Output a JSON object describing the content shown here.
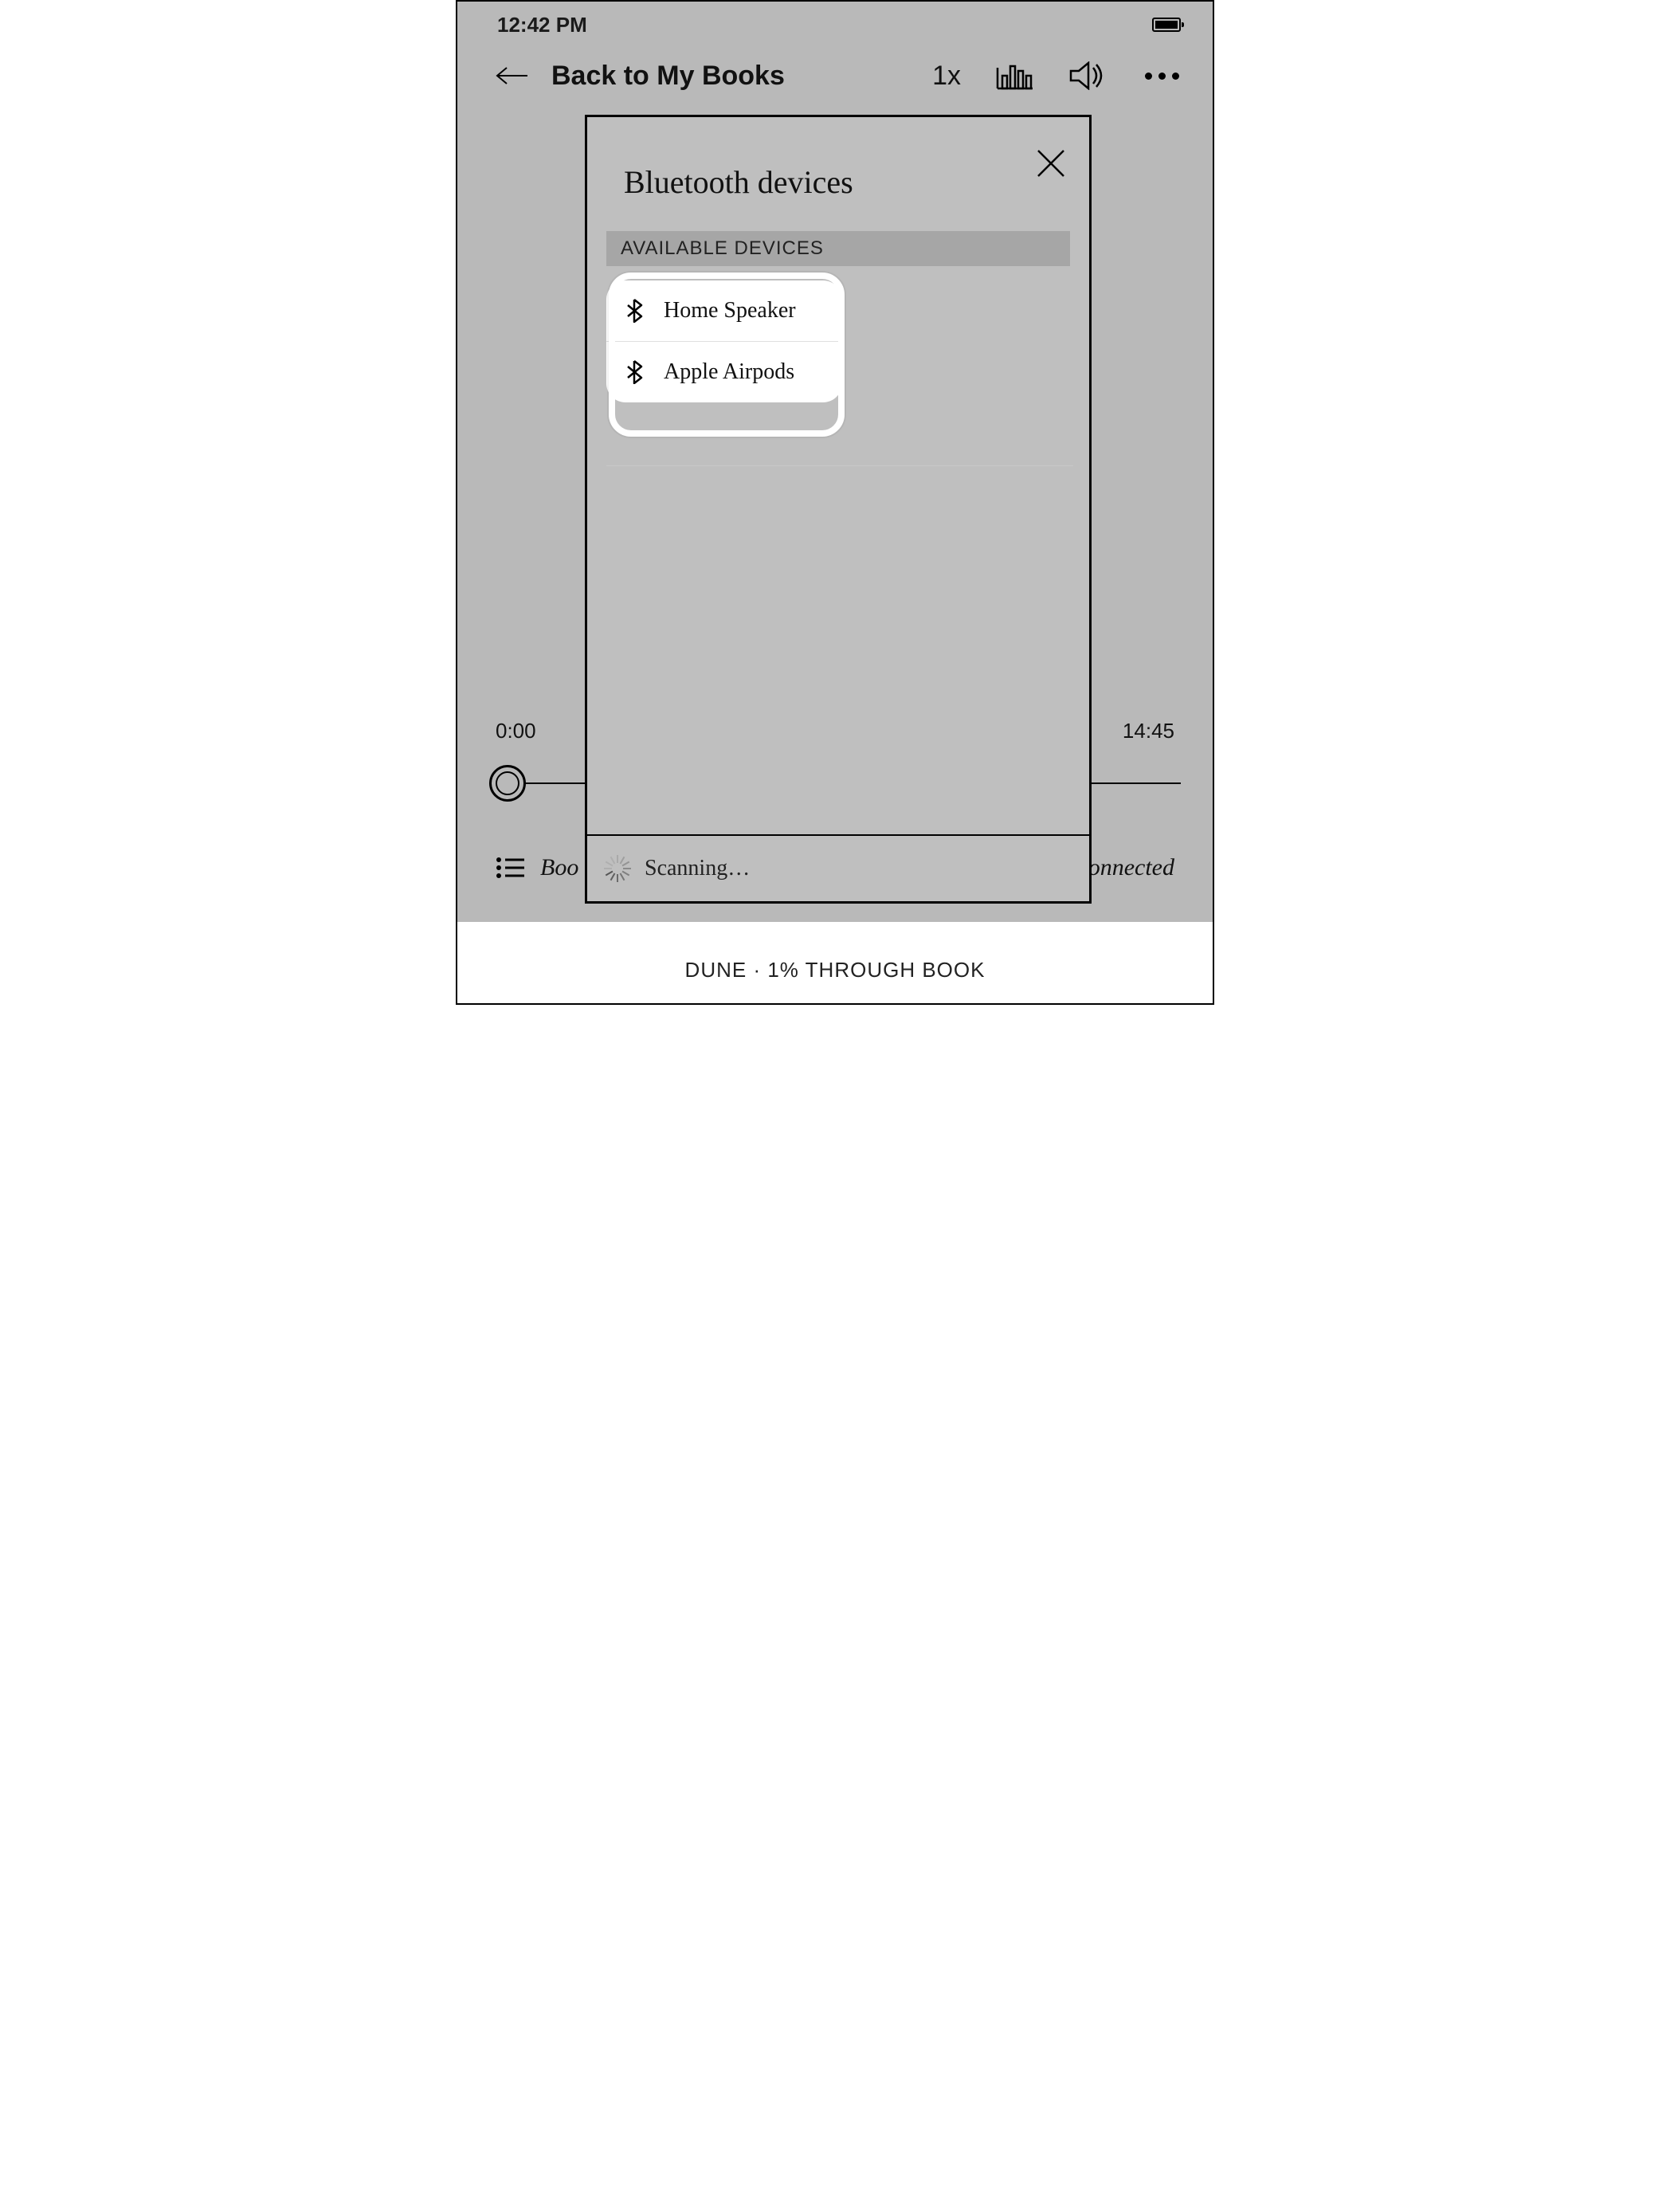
{
  "status": {
    "time": "12:42 PM"
  },
  "nav": {
    "back_label": "Back to My Books",
    "speed": "1x"
  },
  "playback": {
    "elapsed": "0:00",
    "remaining": "14:45"
  },
  "footer": {
    "left_partial": "Boo",
    "right_partial": "onnected"
  },
  "progress": {
    "book_title": "DUNE",
    "separator": " · ",
    "percent_text": "1% THROUGH BOOK"
  },
  "modal": {
    "title": "Bluetooth devices",
    "section_header": "AVAILABLE DEVICES",
    "devices": [
      {
        "name": "Home Speaker"
      },
      {
        "name": "Apple Airpods"
      }
    ],
    "status_text": "Scanning…"
  }
}
